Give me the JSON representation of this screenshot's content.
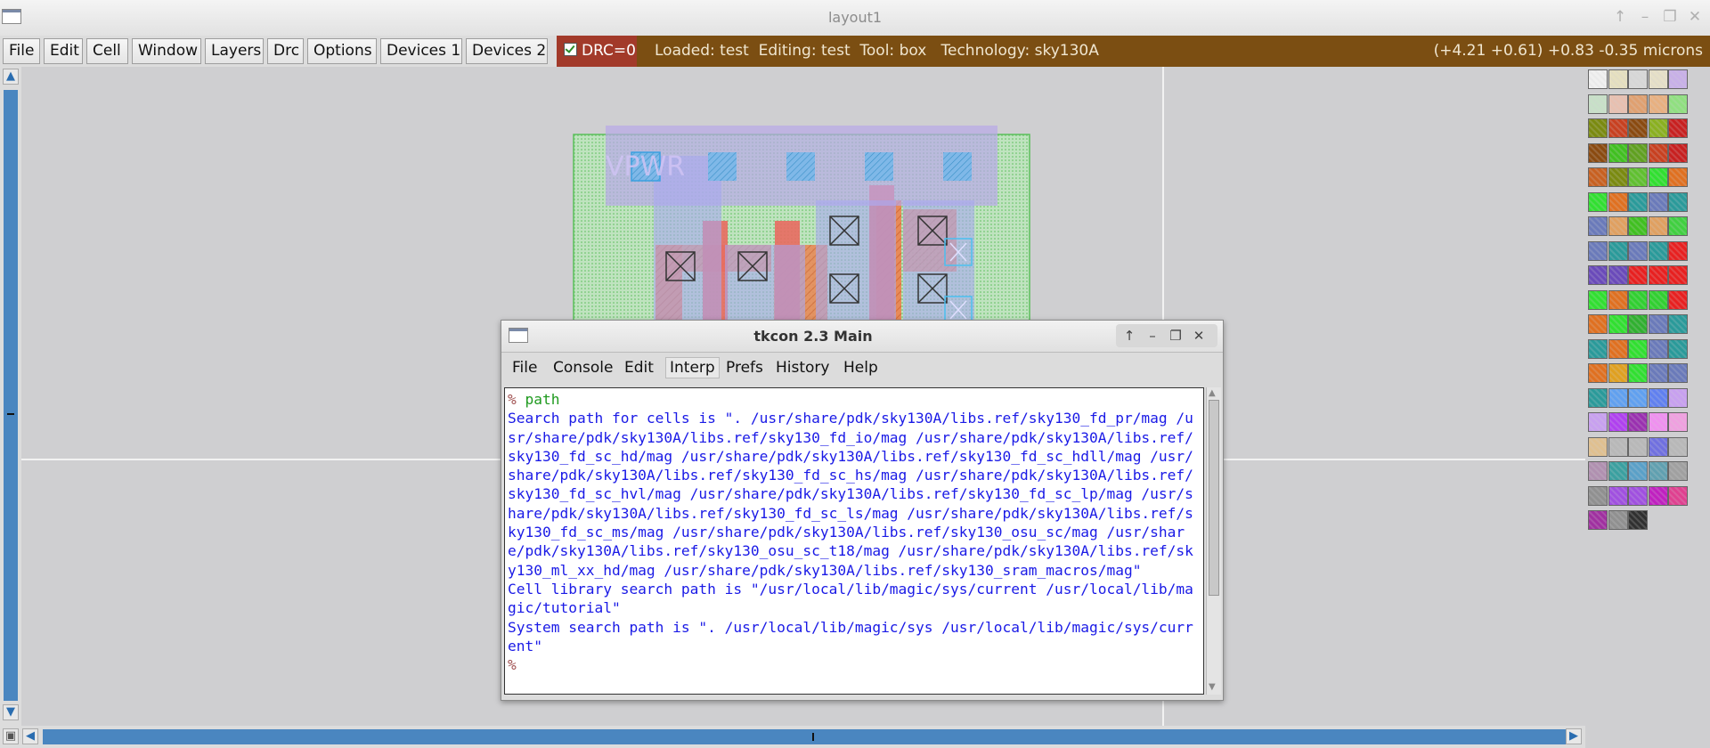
{
  "window": {
    "title": "layout1",
    "controls": [
      "↑",
      "–",
      "❐",
      "✕"
    ]
  },
  "menu": {
    "items": [
      {
        "label": "File"
      },
      {
        "label": "Edit"
      },
      {
        "label": "Cell"
      },
      {
        "label": "Window"
      },
      {
        "label": "Layers"
      },
      {
        "label": "Drc"
      },
      {
        "label": "Options"
      },
      {
        "label": "Devices 1"
      },
      {
        "label": "Devices 2"
      }
    ],
    "drc_label": "DRC=0",
    "drc_checked": true,
    "status_left": "Loaded: test  Editing: test  Tool: box   Technology: sky130A",
    "status_right": "(+4.21 +0.61) +0.83 -0.35 microns"
  },
  "layout": {
    "label_text": "VPWR"
  },
  "colors": {
    "status_bg": "#7b4e12",
    "drc_bg": "#a23a2a",
    "scroll_blue": "#4a86c0",
    "console_text": "#1a1ae6",
    "console_cmd": "#1f9a1f"
  },
  "palette": {
    "swatches": [
      "#f0f0f0",
      "#e6e0c0",
      "#d8d8d8",
      "#e6e0c8",
      "#c8b0e8",
      "#c8e0c8",
      "#e8c0b0",
      "#e0a070",
      "#e8b080",
      "#90e080",
      "#7a8a10",
      "#c84020",
      "#8a4a10",
      "#8ab020",
      "#c82020",
      "#8a4a10",
      "#40c020",
      "#60a020",
      "#c84020",
      "#c82020",
      "#c86020",
      "#7a8a10",
      "#60c030",
      "#30e030",
      "#e07020",
      "#30e030",
      "#e07020",
      "#2a9a9a",
      "#6a7aba",
      "#2a9a9a",
      "#6a7aba",
      "#e0a060",
      "#40c020",
      "#e0a060",
      "#40d040",
      "#6a7aba",
      "#2a9a9a",
      "#6a7aba",
      "#2a9a9a",
      "#e82020",
      "#6a4aba",
      "#6a4aba",
      "#e82020",
      "#e82020",
      "#e82020",
      "#30e030",
      "#e07020",
      "#30d030",
      "#30d030",
      "#e82020",
      "#e07020",
      "#30e030",
      "#30b030",
      "#6a7aba",
      "#2a9a9a",
      "#2a9a9a",
      "#e07020",
      "#30e030",
      "#6a7aba",
      "#2a9a9a",
      "#e07020",
      "#e0a020",
      "#30e030",
      "#6a7aba",
      "#6a7aba",
      "#2a9a9a",
      "#60a0f0",
      "#60a0f0",
      "#6080f0",
      "#c8a0f0",
      "#c8a0f0",
      "#b040f0",
      "#9a30b0",
      "#f090f0",
      "#f0a0e0",
      "#e0c090",
      "#b8b8b8",
      "#b8b8b8",
      "#7070e0",
      "#b8b8b8",
      "#b090b0",
      "#3aa0a0",
      "#5aa0c8",
      "#60a0b0",
      "#a0a0a0",
      "#909090",
      "#a050e0",
      "#a050e0",
      "#c020c0",
      "#e04090",
      "#a030a0",
      "#909090",
      "#303030"
    ]
  },
  "tkcon": {
    "title": "tkcon 2.3 Main",
    "menu": [
      {
        "label": "File"
      },
      {
        "label": "Console"
      },
      {
        "label": "Edit"
      },
      {
        "label": "Interp"
      },
      {
        "label": "Prefs"
      },
      {
        "label": "History"
      },
      {
        "label": "Help"
      }
    ],
    "prompt": "%",
    "command": "path",
    "output": "Search path for cells is \". /usr/share/pdk/sky130A/libs.ref/sky130_fd_pr/mag /usr/share/pdk/sky130A/libs.ref/sky130_fd_io/mag /usr/share/pdk/sky130A/libs.ref/sky130_fd_sc_hd/mag /usr/share/pdk/sky130A/libs.ref/sky130_fd_sc_hdll/mag /usr/share/pdk/sky130A/libs.ref/sky130_fd_sc_hs/mag /usr/share/pdk/sky130A/libs.ref/sky130_fd_sc_hvl/mag /usr/share/pdk/sky130A/libs.ref/sky130_fd_sc_lp/mag /usr/share/pdk/sky130A/libs.ref/sky130_fd_sc_ls/mag /usr/share/pdk/sky130A/libs.ref/sky130_fd_sc_ms/mag /usr/share/pdk/sky130A/libs.ref/sky130_osu_sc/mag /usr/share/pdk/sky130A/libs.ref/sky130_osu_sc_t18/mag /usr/share/pdk/sky130A/libs.ref/sky130_ml_xx_hd/mag /usr/share/pdk/sky130A/libs.ref/sky130_sram_macros/mag\"\nCell library search path is \"/usr/local/lib/magic/sys/current /usr/local/lib/magic/tutorial\"\nSystem search path is \". /usr/local/lib/magic/sys /usr/local/lib/magic/sys/current\"",
    "end_prompt": "%"
  }
}
